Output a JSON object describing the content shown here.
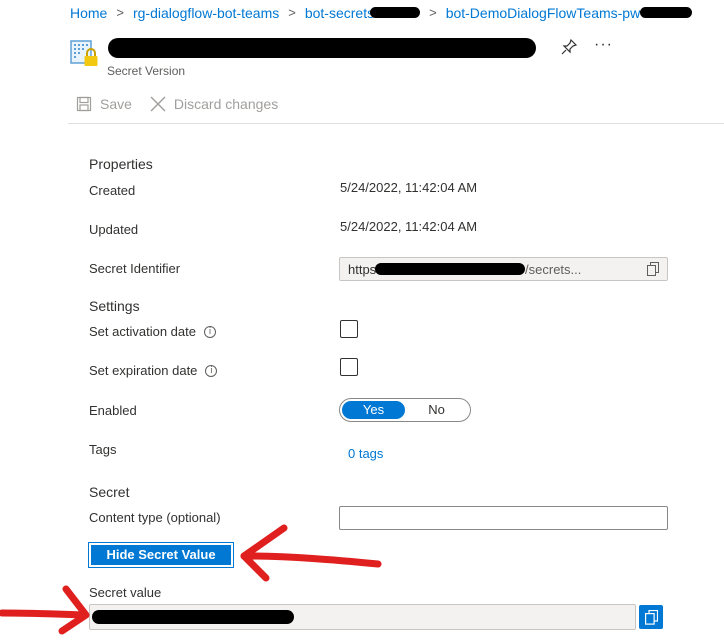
{
  "breadcrumb": {
    "items": [
      "Home",
      "rg-dialogflow-bot-teams",
      "bot-secrets",
      "bot-DemoDialogFlowTeams-pw"
    ]
  },
  "header": {
    "subtitle": "Secret Version",
    "more_label": "···"
  },
  "toolbar": {
    "save_label": "Save",
    "discard_label": "Discard changes"
  },
  "properties": {
    "section_title": "Properties",
    "created_label": "Created",
    "created_value": "5/24/2022, 11:42:04 AM",
    "updated_label": "Updated",
    "updated_value": "5/24/2022, 11:42:04 AM",
    "identifier_label": "Secret Identifier",
    "identifier_prefix": "https://",
    "identifier_suffix": "/secrets..."
  },
  "settings": {
    "section_title": "Settings",
    "activation_label": "Set activation date",
    "activation_checked": false,
    "expiration_label": "Set expiration date",
    "expiration_checked": false,
    "enabled_label": "Enabled",
    "enabled_yes": "Yes",
    "enabled_no": "No",
    "enabled_value": "Yes",
    "tags_label": "Tags",
    "tags_value": "0 tags"
  },
  "secret": {
    "section_title": "Secret",
    "content_type_label": "Content type (optional)",
    "content_type_value": "",
    "hide_button_label": "Hide Secret Value",
    "secret_value_label": "Secret value"
  },
  "icons": {
    "resource": "key-vault-secret-icon",
    "pin": "pin-icon",
    "save": "save-icon",
    "discard": "close-icon",
    "info": "info-icon",
    "copy": "copy-icon"
  },
  "colors": {
    "accent": "#0078d4",
    "annotation_arrow": "#e0201f"
  }
}
